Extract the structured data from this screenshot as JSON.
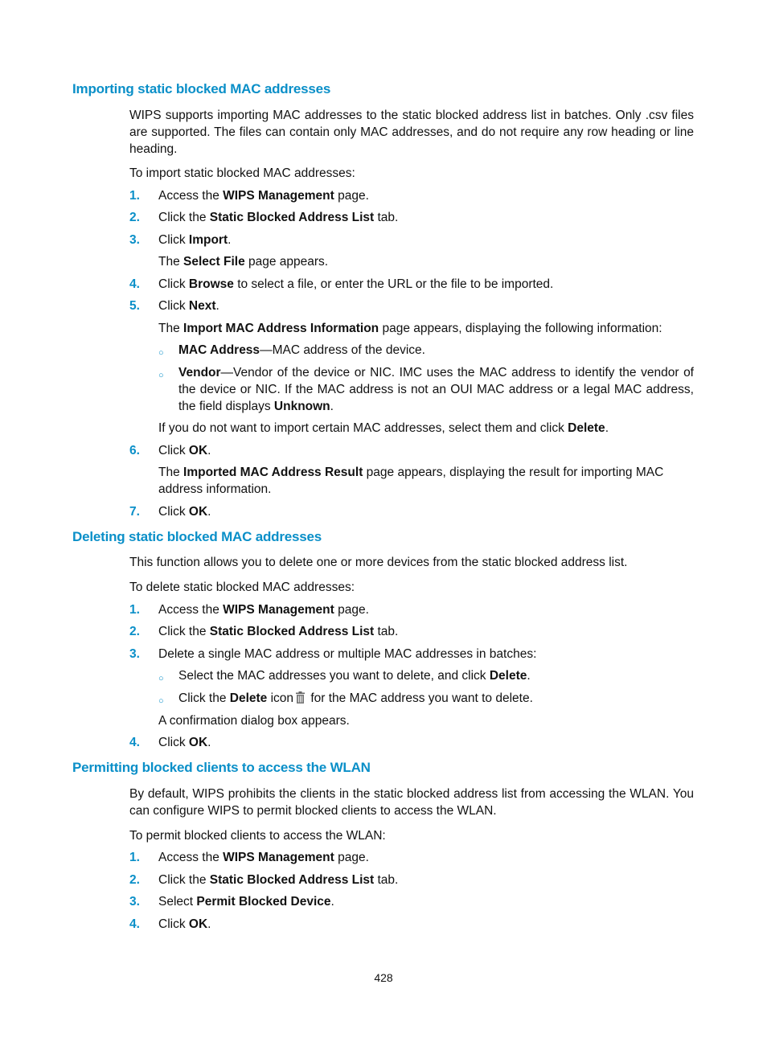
{
  "sections": [
    {
      "heading": "Importing static blocked MAC addresses",
      "intro": "WIPS supports importing MAC addresses to the static blocked address list in batches. Only .csv files are supported. The files can contain only MAC addresses, and do not require any row heading or line heading.",
      "lead": "To import static blocked MAC addresses:",
      "steps": [
        {
          "num": "1.",
          "pre": "Access the ",
          "bold": "WIPS Management",
          "post": " page."
        },
        {
          "num": "2.",
          "pre": "Click the ",
          "bold": "Static Blocked Address List",
          "post": " tab."
        },
        {
          "num": "3.",
          "pre": "Click ",
          "bold": "Import",
          "post": "."
        },
        {
          "num": "4.",
          "pre": "Click ",
          "bold": "Browse",
          "post": " to select a file, or enter the URL or the file to be imported."
        },
        {
          "num": "5.",
          "pre": "Click ",
          "bold": "Next",
          "post": "."
        },
        {
          "num": "6.",
          "pre": "Click ",
          "bold": "OK",
          "post": "."
        },
        {
          "num": "7.",
          "pre": "Click ",
          "bold": "OK",
          "post": "."
        }
      ],
      "step3_note": {
        "pre": "The ",
        "bold": "Select File",
        "post": " page appears."
      },
      "step5_note": {
        "pre": "The ",
        "bold": "Import MAC Address Information",
        "post": " page appears, displaying the following information:"
      },
      "bullets": [
        {
          "bold": "MAC Address",
          "text": "—MAC address of the device."
        },
        {
          "bold": "Vendor",
          "text": "—Vendor of the device or NIC. IMC uses the MAC address to identify the vendor of the device or NIC. If the MAC address is not an OUI MAC address or a legal MAC address, the field displays ",
          "bold2": "Unknown",
          "post": "."
        }
      ],
      "step5_after": {
        "pre": "If you do not want to import certain MAC addresses, select them and click ",
        "bold": "Delete",
        "post": "."
      },
      "step6_note": {
        "pre": "The ",
        "bold": "Imported MAC Address Result",
        "post": " page appears, displaying the result for importing MAC address information."
      }
    },
    {
      "heading": "Deleting static blocked MAC addresses",
      "intro": "This function allows you to delete one or more devices from the static blocked address list.",
      "lead": "To delete static blocked MAC addresses:",
      "steps": [
        {
          "num": "1.",
          "pre": "Access the ",
          "bold": "WIPS Management",
          "post": " page."
        },
        {
          "num": "2.",
          "pre": "Click the ",
          "bold": "Static Blocked Address List",
          "post": " tab."
        },
        {
          "num": "3.",
          "pre": "Delete a single MAC address or multiple MAC addresses in batches:",
          "bold": "",
          "post": ""
        },
        {
          "num": "4.",
          "pre": "Click ",
          "bold": "OK",
          "post": "."
        }
      ],
      "bullets": [
        {
          "pre": "Select the MAC addresses you want to delete, and click ",
          "bold": "Delete",
          "post": "."
        },
        {
          "pre": "Click the ",
          "bold": "Delete",
          "mid": " icon",
          "icon": "trash-icon",
          "post": " for the MAC address you want to delete."
        }
      ],
      "step3_note": "A confirmation dialog box appears."
    },
    {
      "heading": "Permitting blocked clients to access the WLAN",
      "intro": "By default, WIPS prohibits the clients in the static blocked address list from accessing the WLAN. You can configure WIPS to permit blocked clients to access the WLAN.",
      "lead": "To permit blocked clients to access the WLAN:",
      "steps": [
        {
          "num": "1.",
          "pre": "Access the ",
          "bold": "WIPS Management",
          "post": " page."
        },
        {
          "num": "2.",
          "pre": "Click the ",
          "bold": "Static Blocked Address List",
          "post": " tab."
        },
        {
          "num": "3.",
          "pre": "Select ",
          "bold": "Permit Blocked Device",
          "post": "."
        },
        {
          "num": "4.",
          "pre": "Click ",
          "bold": "OK",
          "post": "."
        }
      ]
    }
  ],
  "page_number": "428",
  "colors": {
    "accent": "#0a8fc8",
    "text": "#111111"
  }
}
